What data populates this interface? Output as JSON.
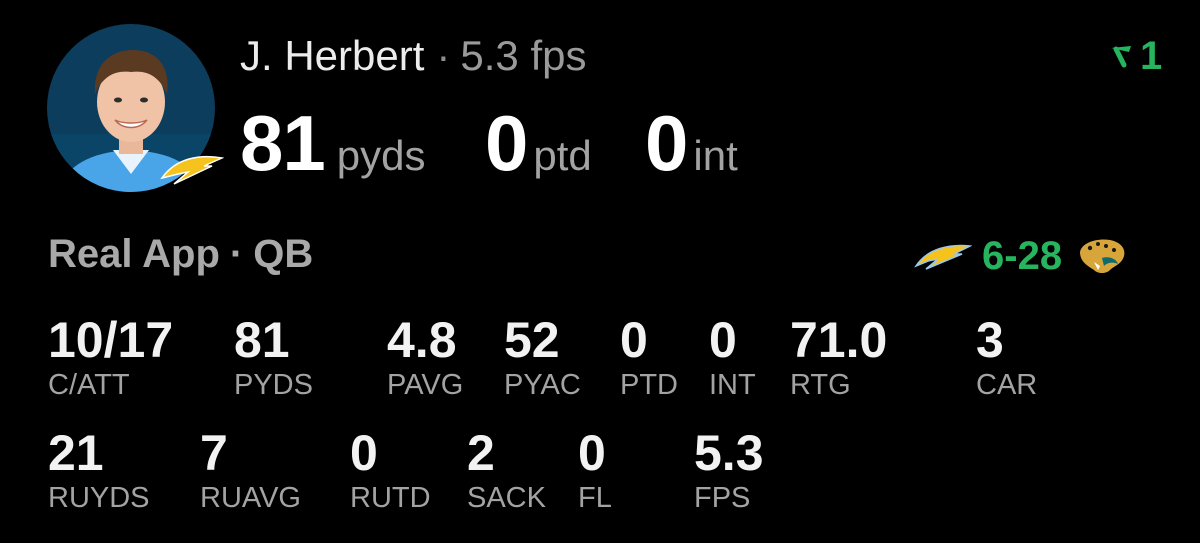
{
  "player": {
    "name": "J. Herbert",
    "separator": "·",
    "fps_value": "5.3",
    "fps_unit": "fps",
    "avatar_icon": "player-headshot",
    "team_icon": "chargers-bolt-logo"
  },
  "trend": {
    "icon": "trend-up-arrow-icon",
    "value": "1",
    "color": "#27b45f"
  },
  "headline": {
    "passing_yards": "81",
    "passing_yards_unit": "pyds",
    "passing_td": "0",
    "passing_td_unit": "ptd",
    "interceptions": "0",
    "interceptions_unit": "int"
  },
  "subheader": {
    "source": "Real App",
    "separator": "·",
    "position": "QB"
  },
  "game": {
    "home_icon": "chargers-bolt-logo",
    "score": "6-28",
    "score_color": "#27b45f",
    "away_icon": "jaguars-logo"
  },
  "stats_row1": [
    {
      "value": "10/17",
      "label": "C/ATT"
    },
    {
      "value": "81",
      "label": "PYDS"
    },
    {
      "value": "4.8",
      "label": "PAVG"
    },
    {
      "value": "52",
      "label": "PYAC"
    },
    {
      "value": "0",
      "label": "PTD"
    },
    {
      "value": "0",
      "label": "INT"
    },
    {
      "value": "71.0",
      "label": "RTG"
    },
    {
      "value": "3",
      "label": "CAR"
    }
  ],
  "stats_row2": [
    {
      "value": "21",
      "label": "RUYDS"
    },
    {
      "value": "7",
      "label": "RUAVG"
    },
    {
      "value": "0",
      "label": "RUTD"
    },
    {
      "value": "2",
      "label": "SACK"
    },
    {
      "value": "0",
      "label": "FL"
    },
    {
      "value": "5.3",
      "label": "FPS"
    }
  ],
  "colors": {
    "background": "#000000",
    "accent_green": "#27b45f",
    "muted_text": "#a3a3a3"
  }
}
